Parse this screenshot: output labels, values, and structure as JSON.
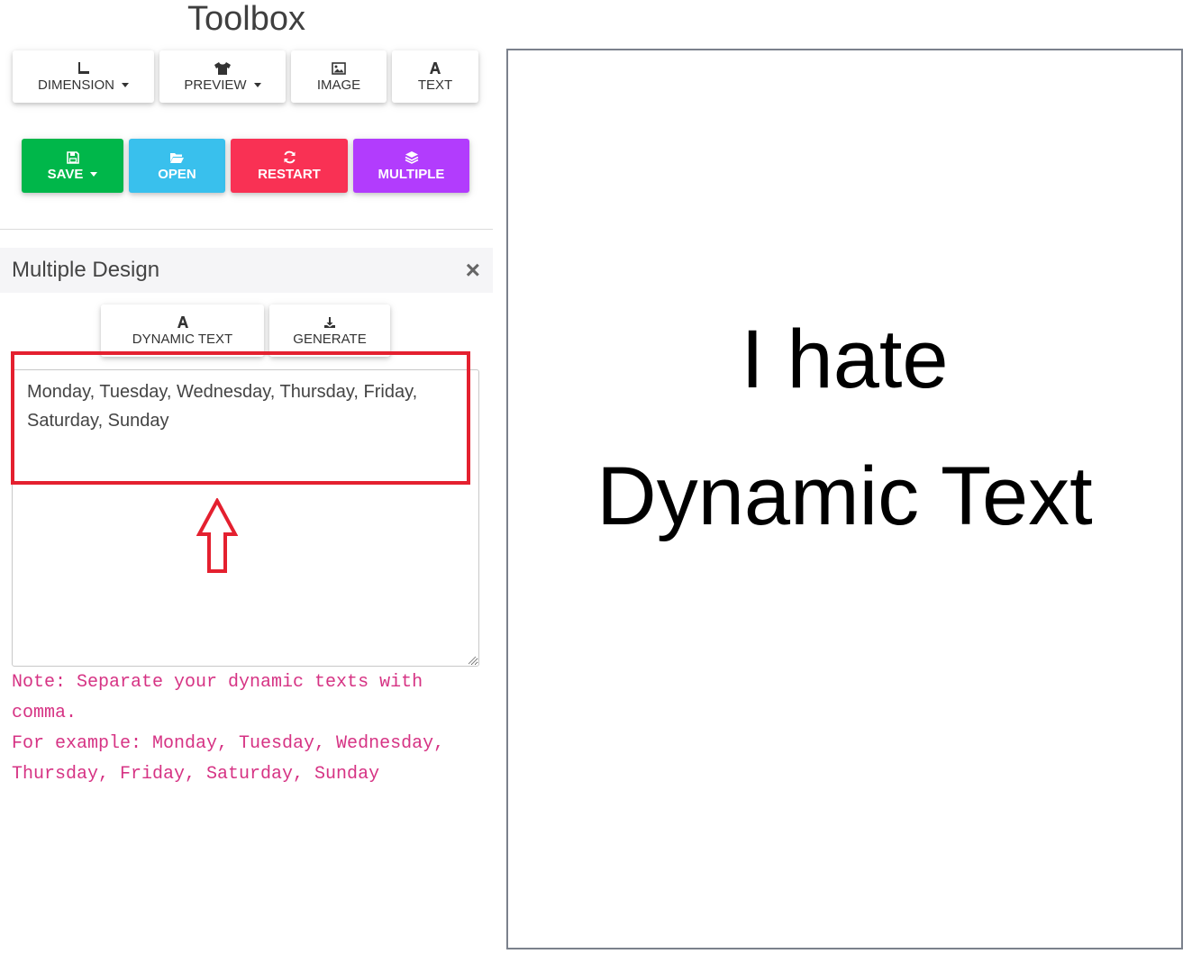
{
  "toolbox": {
    "title": "Toolbox",
    "tools": [
      {
        "label": "DIMENSION",
        "icon": "ruler-icon",
        "dropdown": true
      },
      {
        "label": "PREVIEW",
        "icon": "tshirt-icon",
        "dropdown": true
      },
      {
        "label": "IMAGE",
        "icon": "image-icon",
        "dropdown": false
      },
      {
        "label": "TEXT",
        "icon": "font-icon",
        "dropdown": false
      }
    ],
    "actions": [
      {
        "label": "SAVE",
        "icon": "floppy-icon",
        "color": "#00b74a",
        "dropdown": true
      },
      {
        "label": "OPEN",
        "icon": "folder-open-icon",
        "color": "#39c0ed",
        "dropdown": false
      },
      {
        "label": "RESTART",
        "icon": "refresh-icon",
        "color": "#f93154",
        "dropdown": false
      },
      {
        "label": "MULTIPLE",
        "icon": "layers-icon",
        "color": "#b23cfd",
        "dropdown": false
      }
    ]
  },
  "multiple_design": {
    "title": "Multiple Design",
    "close_label": "×",
    "buttons": [
      {
        "label": "DYNAMIC TEXT",
        "icon": "font-icon"
      },
      {
        "label": "GENERATE",
        "icon": "download-icon"
      }
    ],
    "textarea_value": "Monday, Tuesday, Wednesday, Thursday, Friday, Saturday, Sunday",
    "note_line1": "Note: Separate your dynamic texts with comma.",
    "note_line2": "For example: Monday, Tuesday, Wednesday, Thursday, Friday, Saturday, Sunday"
  },
  "canvas": {
    "line1": "I hate",
    "line2": "Dynamic Text"
  },
  "annotation": {
    "color": "#e4202f"
  }
}
